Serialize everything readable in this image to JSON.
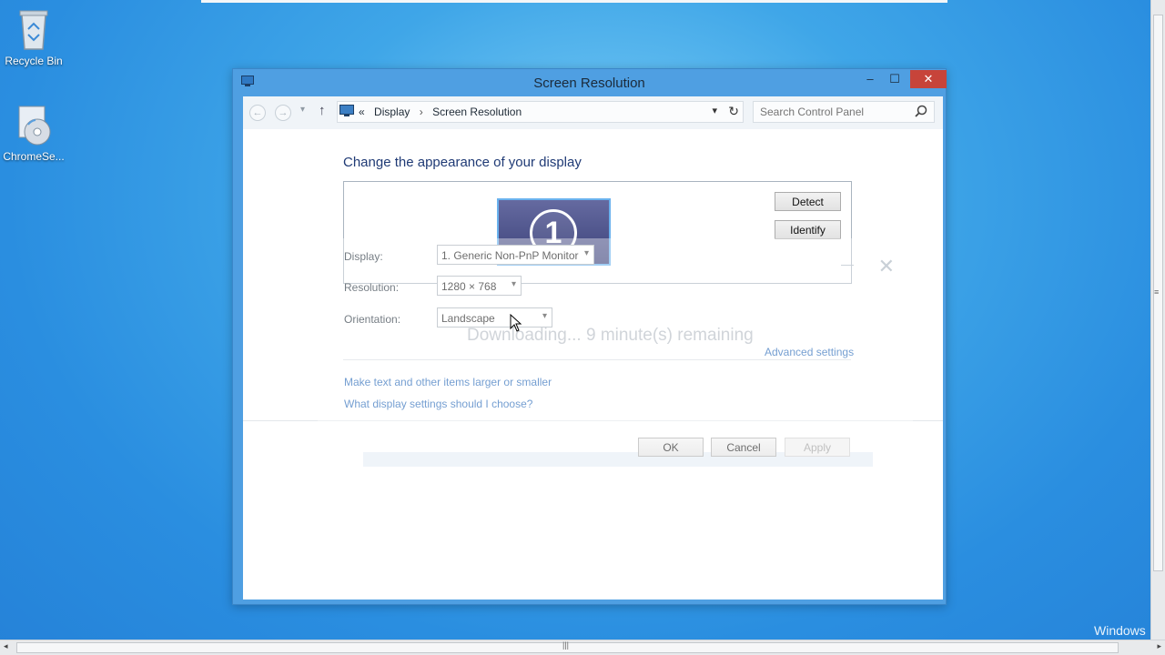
{
  "desktop": {
    "icons": [
      {
        "label": "Recycle Bin",
        "icon": "recycle-bin-icon"
      },
      {
        "label": "ChromeSe...",
        "icon": "cd-disc-icon"
      }
    ],
    "watermark": "Windows"
  },
  "window": {
    "title": "Screen Resolution",
    "controls": {
      "minimize": "–",
      "maximize": "☐",
      "close": "✕"
    },
    "close_color": "#c7443a",
    "accent": "#4f9fe2"
  },
  "addressbar": {
    "prefix": "«",
    "crumbs": [
      "Display",
      "Screen Resolution"
    ],
    "separator": "›",
    "search_placeholder": "Search Control Panel"
  },
  "main": {
    "heading": "Change the appearance of your display",
    "monitor_number": "1",
    "detect_label": "Detect",
    "identify_label": "Identify",
    "display_label": "Display:",
    "display_value": "1. Generic Non-PnP Monitor",
    "resolution_label": "Resolution:",
    "resolution_value": "1280 × 768",
    "orientation_label": "Orientation:",
    "orientation_value": "Landscape",
    "advanced_link": "Advanced settings",
    "link_text_size": "Make text and other items larger or smaller",
    "link_help": "What display settings should I choose?",
    "ok_label": "OK",
    "cancel_label": "Cancel",
    "apply_label": "Apply"
  },
  "overlay": {
    "message": "Downloading... 9 minute(s) remaining"
  }
}
